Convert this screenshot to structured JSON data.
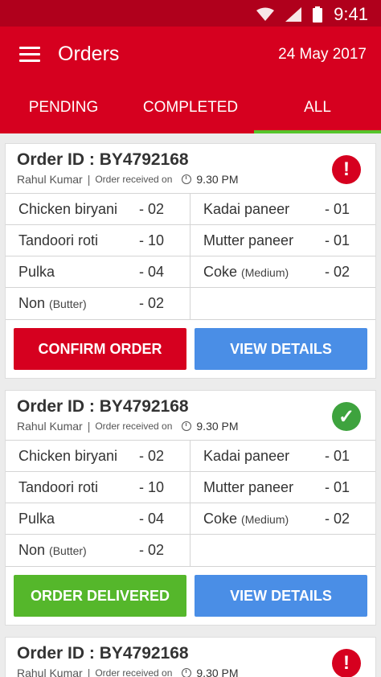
{
  "status_bar": {
    "time": "9:41"
  },
  "app_bar": {
    "title": "Orders",
    "date": "24 May 2017"
  },
  "tabs": [
    {
      "label": "PENDING"
    },
    {
      "label": "COMPLETED"
    },
    {
      "label": "ALL"
    }
  ],
  "orders": [
    {
      "order_id_label": "Order ID : ",
      "order_id": "BY4792168",
      "customer": "Rahul Kumar",
      "received_label": "Order received on",
      "time": "9.30 PM",
      "status_icon": "alert-icon",
      "items": [
        {
          "name": "Chicken biryani",
          "note": "",
          "qty": "- 02"
        },
        {
          "name": "Kadai paneer",
          "note": "",
          "qty": "- 01"
        },
        {
          "name": "Tandoori roti",
          "note": "",
          "qty": "- 10"
        },
        {
          "name": "Mutter paneer",
          "note": "",
          "qty": "- 01"
        },
        {
          "name": "Pulka",
          "note": "",
          "qty": "- 04"
        },
        {
          "name": "Coke",
          "note": "(Medium)",
          "qty": "- 02"
        },
        {
          "name": "Non",
          "note": "(Butter)",
          "qty": "- 02"
        },
        {
          "name": "",
          "note": "",
          "qty": ""
        }
      ],
      "primary_action": "CONFIRM ORDER",
      "secondary_action": "VIEW DETAILS"
    },
    {
      "order_id_label": "Order ID : ",
      "order_id": "BY4792168",
      "customer": "Rahul Kumar",
      "received_label": "Order received on",
      "time": "9.30 PM",
      "status_icon": "check-icon",
      "items": [
        {
          "name": "Chicken biryani",
          "note": "",
          "qty": "- 02"
        },
        {
          "name": "Kadai paneer",
          "note": "",
          "qty": "- 01"
        },
        {
          "name": "Tandoori roti",
          "note": "",
          "qty": "- 10"
        },
        {
          "name": "Mutter paneer",
          "note": "",
          "qty": "- 01"
        },
        {
          "name": "Pulka",
          "note": "",
          "qty": "- 04"
        },
        {
          "name": "Coke",
          "note": "(Medium)",
          "qty": "- 02"
        },
        {
          "name": "Non",
          "note": "(Butter)",
          "qty": "- 02"
        },
        {
          "name": "",
          "note": "",
          "qty": ""
        }
      ],
      "primary_action": "ORDER DELIVERED",
      "secondary_action": "VIEW DETAILS"
    },
    {
      "order_id_label": "Order ID : ",
      "order_id": "BY4792168",
      "customer": "Rahul Kumar",
      "received_label": "Order received on",
      "time": "9.30 PM",
      "status_icon": "alert-icon"
    }
  ],
  "colors": {
    "primary": "#d6001f",
    "status_bar": "#b0001c",
    "success": "#55b72b",
    "info": "#4a8ee6",
    "tab_indicator": "#55c42b"
  }
}
